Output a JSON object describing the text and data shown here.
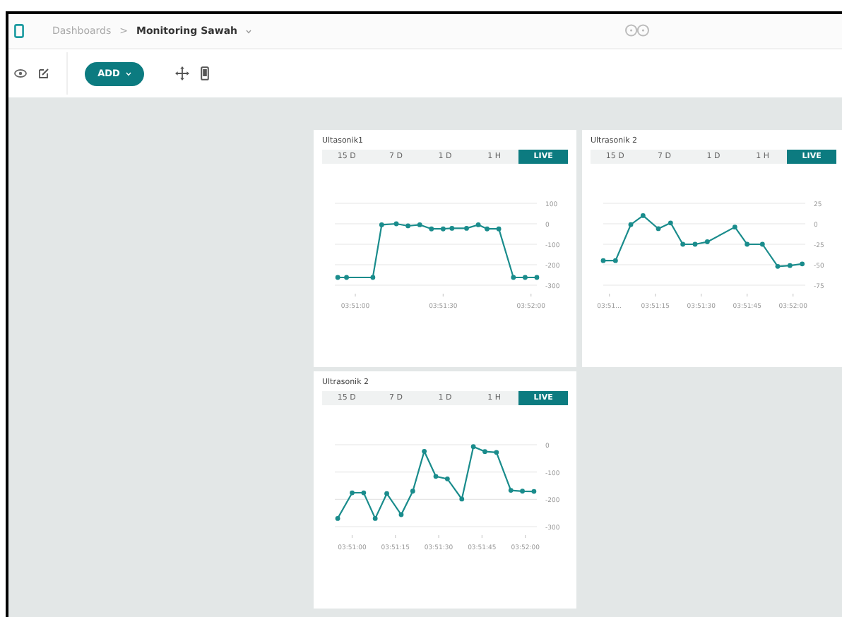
{
  "breadcrumb": {
    "parent": "Dashboards",
    "separator": ">",
    "current": "Monitoring Sawah"
  },
  "toolbar": {
    "add_button": "ADD"
  },
  "widgets": [
    {
      "title": "Ultasonik1",
      "tabs": [
        {
          "label": "15 D",
          "selected": false
        },
        {
          "label": "7 D",
          "selected": false
        },
        {
          "label": "1 D",
          "selected": false
        },
        {
          "label": "1 H",
          "selected": false
        },
        {
          "label": "LIVE",
          "selected": true
        }
      ],
      "chart_data": {
        "type": "line",
        "xlim": [
          13853,
          13922
        ],
        "grid": true,
        "ylim": [
          -300,
          100
        ],
        "xticks": [
          {
            "value": 13860,
            "label": "03:51:00"
          },
          {
            "value": 13890,
            "label": "03:51:30"
          },
          {
            "value": 13920,
            "label": "03:52:00"
          }
        ],
        "yticks": [
          100,
          0,
          -100,
          -200,
          -300
        ],
        "series": [
          {
            "color": "#1a8c8c",
            "marker": true,
            "x": [
              13854,
              13857,
              13866,
              13869,
              13874,
              13878,
              13882,
              13886,
              13890,
              13893,
              13898,
              13902,
              13905,
              13909,
              13914,
              13918,
              13922
            ],
            "values": [
              -262,
              -262,
              -262,
              -5,
              0,
              -10,
              -5,
              -25,
              -25,
              -22,
              -22,
              -5,
              -25,
              -25,
              -262,
              -262,
              -262
            ]
          }
        ]
      }
    },
    {
      "title": "Ultrasonik 2",
      "tabs": [
        {
          "label": "15 D",
          "selected": false
        },
        {
          "label": "7 D",
          "selected": false
        },
        {
          "label": "1 D",
          "selected": false
        },
        {
          "label": "1 H",
          "selected": false
        },
        {
          "label": "LIVE",
          "selected": true
        }
      ],
      "chart_data": {
        "type": "line",
        "xlim": [
          13858,
          13924
        ],
        "grid": true,
        "ylim": [
          -75,
          25
        ],
        "xticks": [
          {
            "value": 13860,
            "label": "03:51…"
          },
          {
            "value": 13875,
            "label": "03:51:15"
          },
          {
            "value": 13890,
            "label": "03:51:30"
          },
          {
            "value": 13905,
            "label": "03:51:45"
          },
          {
            "value": 13920,
            "label": "03:52:00"
          }
        ],
        "yticks": [
          25,
          0,
          -25,
          -50,
          -75
        ],
        "series": [
          {
            "color": "#1a8c8c",
            "marker": true,
            "x": [
              13858,
              13862,
              13867,
              13871,
              13876,
              13880,
              13884,
              13888,
              13892,
              13901,
              13905,
              13910,
              13915,
              13919,
              13923
            ],
            "values": [
              -45,
              -45,
              -1,
              10,
              -6,
              1,
              -25,
              -25,
              -22,
              -4,
              -25,
              -25,
              -52,
              -51,
              -49
            ]
          }
        ]
      }
    },
    {
      "title": "Ultrasonik 2",
      "tabs": [
        {
          "label": "15 D",
          "selected": false
        },
        {
          "label": "7 D",
          "selected": false
        },
        {
          "label": "1 D",
          "selected": false
        },
        {
          "label": "1 H",
          "selected": false
        },
        {
          "label": "LIVE",
          "selected": true
        }
      ],
      "chart_data": {
        "type": "line",
        "xlim": [
          13854,
          13924
        ],
        "grid": true,
        "ylim": [
          -300,
          0
        ],
        "xticks": [
          {
            "value": 13860,
            "label": "03:51:00"
          },
          {
            "value": 13875,
            "label": "03:51:15"
          },
          {
            "value": 13890,
            "label": "03:51:30"
          },
          {
            "value": 13905,
            "label": "03:51:45"
          },
          {
            "value": 13920,
            "label": "03:52:00"
          }
        ],
        "yticks": [
          0,
          -100,
          -200,
          -300
        ],
        "series": [
          {
            "color": "#1a8c8c",
            "marker": true,
            "x": [
              13855,
              13860,
              13864,
              13868,
              13872,
              13877,
              13881,
              13885,
              13889,
              13893,
              13898,
              13902,
              13906,
              13910,
              13915,
              13919,
              13923
            ],
            "values": [
              -270,
              -176,
              -176,
              -270,
              -179,
              -256,
              -170,
              -24,
              -116,
              -125,
              -199,
              -7,
              -25,
              -28,
              -167,
              -170,
              -171
            ]
          }
        ]
      }
    }
  ]
}
